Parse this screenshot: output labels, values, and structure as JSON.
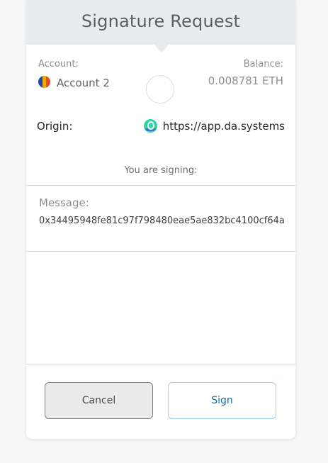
{
  "header": {
    "title": "Signature Request"
  },
  "account": {
    "label": "Account:",
    "name": "Account 2"
  },
  "balance": {
    "label": "Balance:",
    "value": "0.008781 ETH"
  },
  "origin": {
    "label": "Origin:",
    "url": "https://app.da.systems"
  },
  "signing": {
    "text": "You are signing:"
  },
  "message": {
    "label": "Message:",
    "value": "0x34495948fe81c97f798480eae5ae832bc4100cf64a"
  },
  "buttons": {
    "cancel": "Cancel",
    "sign": "Sign"
  },
  "colors": {
    "accent": "#0f6fae",
    "header_bg": "#e9ecef"
  }
}
